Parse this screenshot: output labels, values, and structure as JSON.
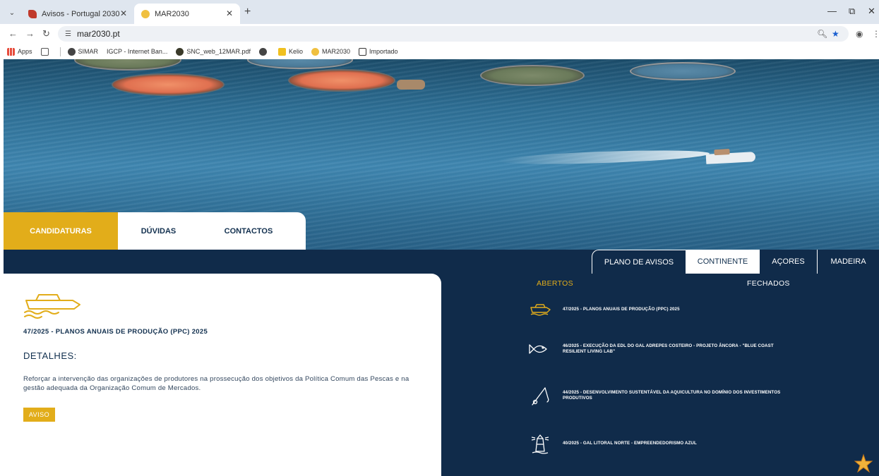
{
  "browser": {
    "tabs": [
      {
        "title": "Avisos - Portugal 2030",
        "active": false
      },
      {
        "title": "MAR2030",
        "active": true
      }
    ],
    "url": "mar2030.pt",
    "bookmarks": [
      {
        "label": "Apps"
      },
      {
        "label": "SIMAR"
      },
      {
        "label": "IGCP - Internet Ban..."
      },
      {
        "label": "SNC_web_12MAR.pdf"
      },
      {
        "label": "Kelio"
      },
      {
        "label": "MAR2030"
      },
      {
        "label": "Importado"
      }
    ]
  },
  "nav": {
    "items": [
      "CANDIDATURAS",
      "DÚVIDAS",
      "CONTACTOS"
    ],
    "active": "CANDIDATURAS"
  },
  "regions": {
    "tabs": [
      "PLANO DE AVISOS",
      "CONTINENTE",
      "AÇORES",
      "MADEIRA"
    ],
    "active": "CONTINENTE"
  },
  "detail": {
    "title": "47/2025 - PLANOS ANUAIS DE PRODUÇÃO (PPC) 2025",
    "subtitle": "DETALHES:",
    "text": "Reforçar a intervenção das organizações de produtores na prossecução dos objetivos da Política Comum das Pescas e na gestão adequada da Organização Comum de Mercados.",
    "button": "AVISO"
  },
  "filters": {
    "open": "ABERTOS",
    "closed": "FECHADOS",
    "active": "ABERTOS"
  },
  "notices": [
    {
      "label": "47/2025 - PLANOS ANUAIS DE PRODUÇÃO (PPC) 2025",
      "icon": "boat-icon",
      "highlight": true
    },
    {
      "label": "46/2025 - EXECUÇÃO DA EDL DO GAL ADREPES COSTEIRO - PROJETO ÂNCORA - \"BLUE COAST RESILIENT LIVING LAB\"",
      "icon": "fish-icon",
      "highlight": false
    },
    {
      "label": "44/2025 - DESENVOLVIMENTO SUSTENTÁVEL DA AQUICULTURA NO DOMÍNIO DOS INVESTIMENTOS PRODUTIVOS",
      "icon": "fishing-rod-icon",
      "highlight": false
    },
    {
      "label": "40/2025 - GAL LITORAL NORTE - EMPREENDEDORISMO AZUL",
      "icon": "lighthouse-icon",
      "highlight": false
    }
  ],
  "colors": {
    "navy": "#102b4a",
    "gold": "#e2ad1a",
    "white": "#ffffff"
  }
}
